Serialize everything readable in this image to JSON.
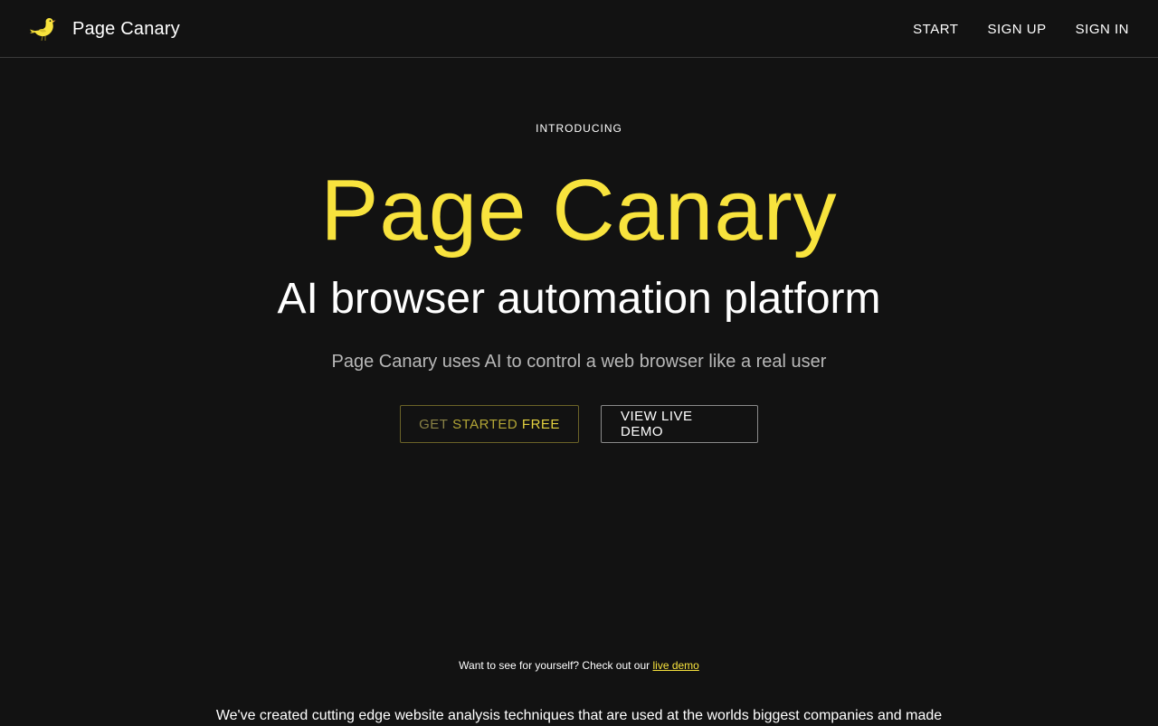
{
  "header": {
    "brand": "Page Canary",
    "logo_icon": "canary-bird-icon",
    "nav": [
      {
        "label": "START"
      },
      {
        "label": "SIGN UP"
      },
      {
        "label": "SIGN IN"
      }
    ]
  },
  "hero": {
    "eyebrow": "INTRODUCING",
    "title": "Page Canary",
    "subtitle": "AI browser automation platform",
    "description": "Page Canary uses AI to control a web browser like a real user",
    "primary_cta": {
      "word1": "GET",
      "word2": "STARTED",
      "word3": "FREE"
    },
    "secondary_cta": "VIEW LIVE DEMO"
  },
  "demo_note": {
    "text": "Want to see for yourself? Check out our",
    "link": "live demo"
  },
  "body": {
    "text": "We've created cutting edge website analysis techniques that are used at the worlds biggest companies and made"
  },
  "colors": {
    "background": "#121212",
    "accent": "#f8e33d"
  }
}
